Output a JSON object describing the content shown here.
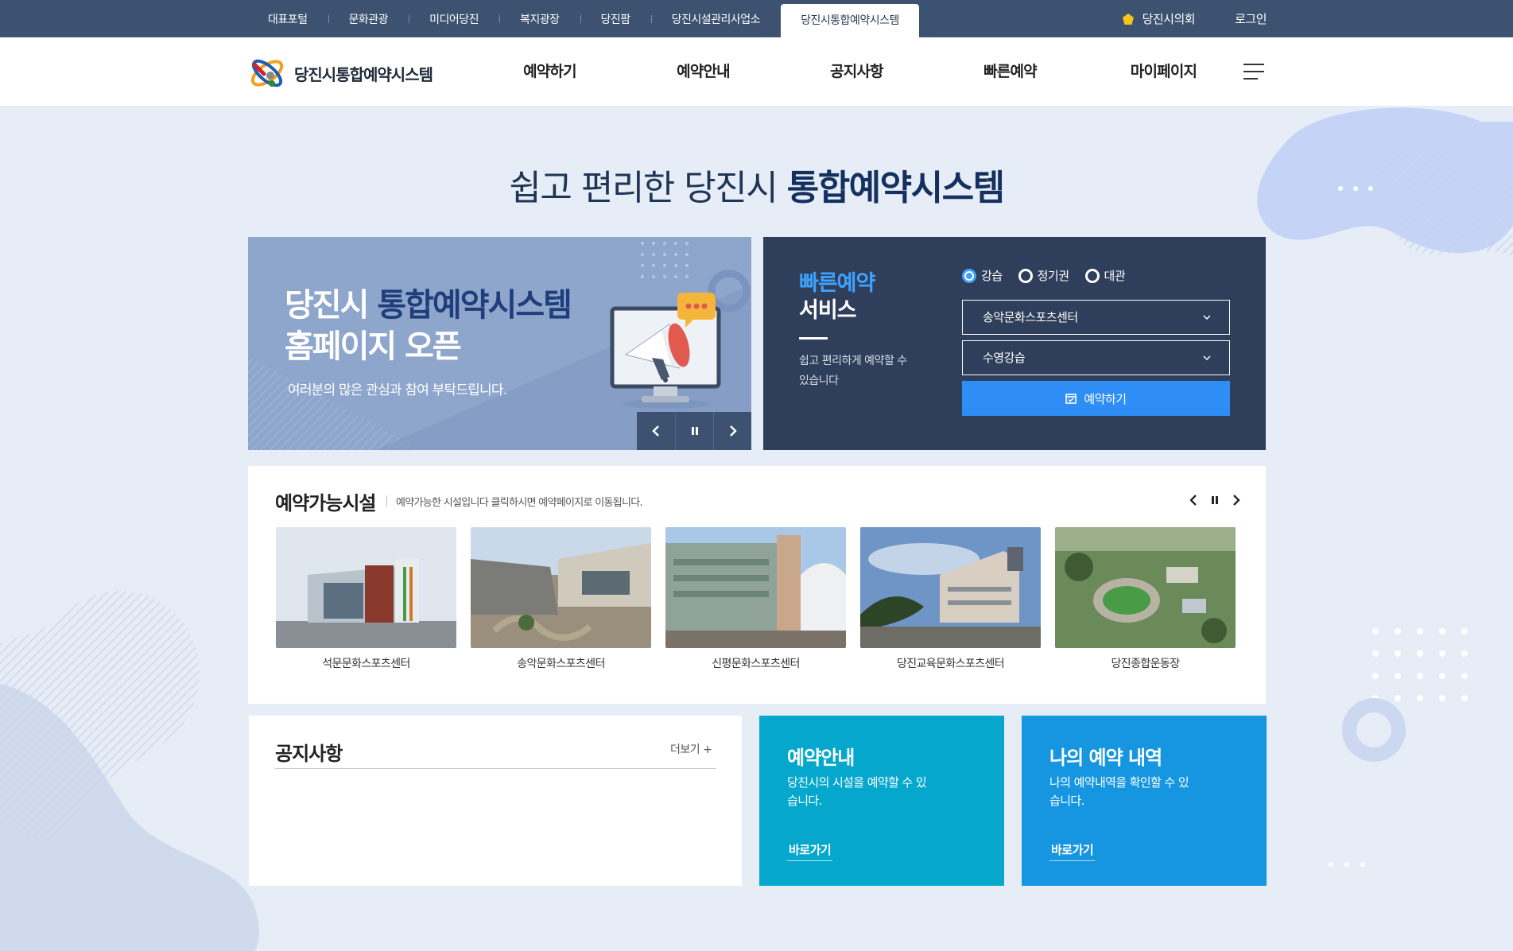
{
  "topbar": {
    "links": [
      "대표포털",
      "문화관광",
      "미디어당진",
      "복지광장",
      "당진팜",
      "당진시설관리사업소",
      "당진시통합예약시스템"
    ],
    "council": "당진시의회",
    "login": "로그인"
  },
  "header": {
    "logo_text": "당진시통합예약시스템",
    "nav": [
      "예약하기",
      "예약안내",
      "공지사항",
      "빠른예약",
      "마이페이지"
    ]
  },
  "hero": {
    "title_light": "쉽고 편리한 당진시 ",
    "title_bold": "통합예약시스템"
  },
  "banner": {
    "line1_a": "당진시 ",
    "line1_b": "통합예약시스템",
    "line2": "홈페이지 오픈",
    "sub": "여러분의 많은 관심과 참여 부탁드립니다."
  },
  "quick": {
    "title1": "빠른예약",
    "title2": "서비스",
    "desc": "쉽고 편리하게 예약할 수 있습니다",
    "radios": [
      {
        "label": "강습",
        "checked": true
      },
      {
        "label": "정기권",
        "checked": false
      },
      {
        "label": "대관",
        "checked": false
      }
    ],
    "select1": "송악문화스포츠센터",
    "select2": "수영강습",
    "button": "예약하기"
  },
  "facilities": {
    "title": "예약가능시설",
    "desc": "예약가능한 시설입니다 클릭하시면 예약페이지로 이동됩니다.",
    "items": [
      {
        "name": "석문문화스포츠센터"
      },
      {
        "name": "송악문화스포츠센터"
      },
      {
        "name": "신평문화스포츠센터"
      },
      {
        "name": "당진교육문화스포츠센터"
      },
      {
        "name": "당진종합운동장"
      }
    ]
  },
  "notice": {
    "title": "공지사항",
    "more": "더보기 +"
  },
  "guide": {
    "title": "예약안내",
    "desc": "당진시의 시설을 예약할 수 있습니다.",
    "link": "바로가기",
    "color": "#05a8cc"
  },
  "myres": {
    "title": "나의 예약 내역",
    "desc": "나의 예약내역을 확인할 수 있습니다.",
    "link": "바로가기",
    "color": "#1696e0"
  }
}
